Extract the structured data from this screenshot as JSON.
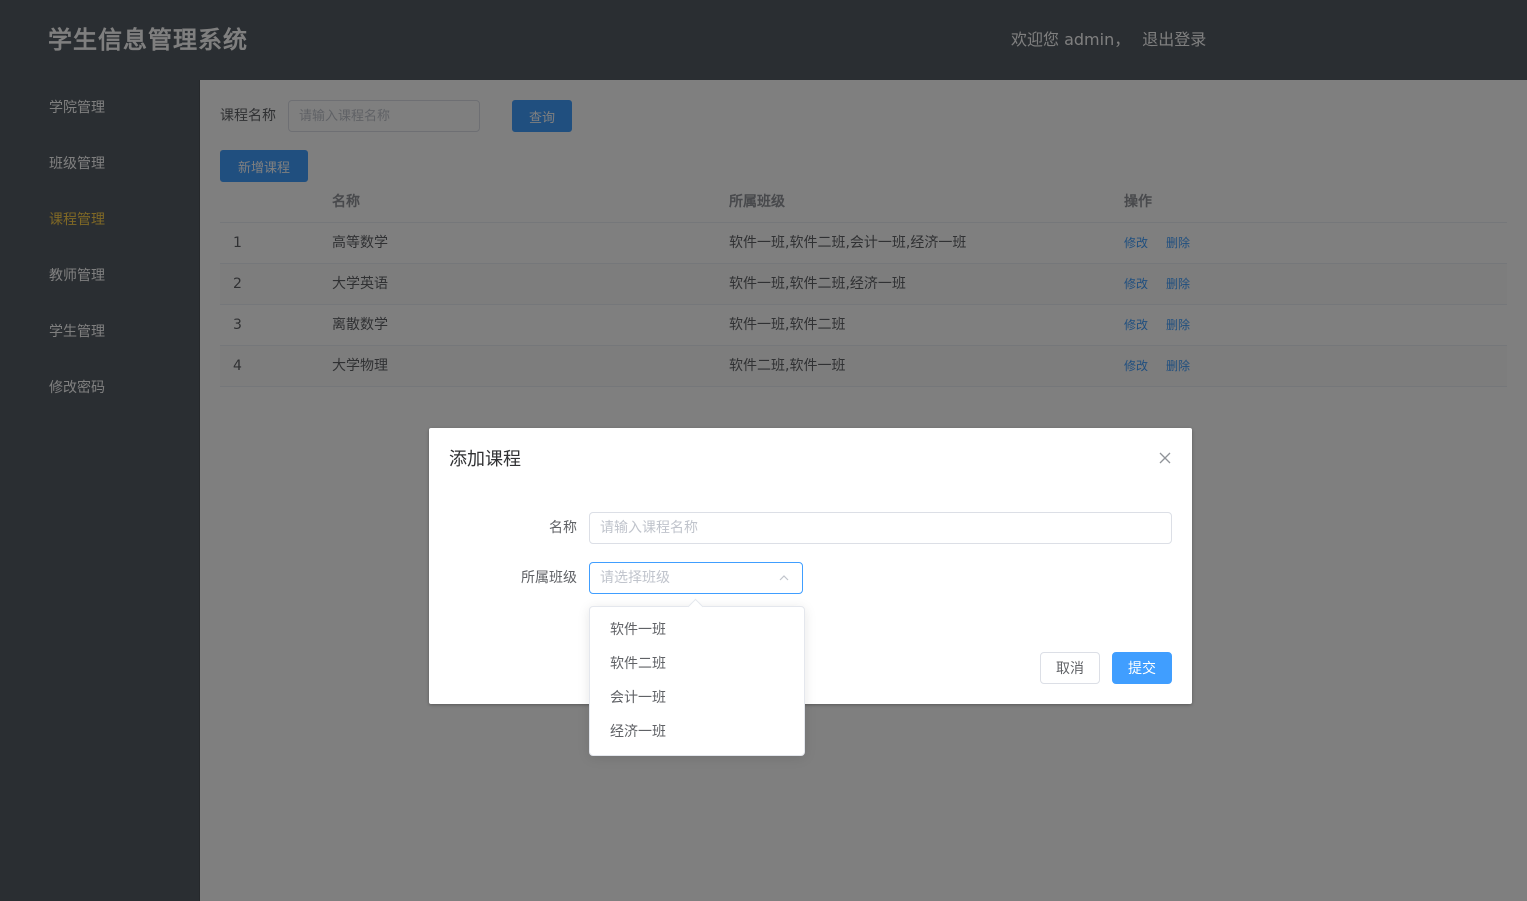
{
  "header": {
    "title": "学生信息管理系统",
    "welcome": "欢迎您 admin，",
    "logout": "退出登录"
  },
  "sidebar": {
    "items": [
      {
        "label": "学院管理",
        "active": false
      },
      {
        "label": "班级管理",
        "active": false
      },
      {
        "label": "课程管理",
        "active": true
      },
      {
        "label": "教师管理",
        "active": false
      },
      {
        "label": "学生管理",
        "active": false
      },
      {
        "label": "修改密码",
        "active": false
      }
    ]
  },
  "search": {
    "label": "课程名称",
    "placeholder": "请输入课程名称",
    "query_button": "查询"
  },
  "toolbar": {
    "add_button": "新增课程"
  },
  "table": {
    "columns": [
      "",
      "名称",
      "所属班级",
      "操作"
    ],
    "rows": [
      {
        "index": "1",
        "name": "高等数学",
        "classes": "软件一班,软件二班,会计一班,经济一班"
      },
      {
        "index": "2",
        "name": "大学英语",
        "classes": "软件一班,软件二班,经济一班"
      },
      {
        "index": "3",
        "name": "离散数学",
        "classes": "软件一班,软件二班"
      },
      {
        "index": "4",
        "name": "大学物理",
        "classes": "软件二班,软件一班"
      }
    ],
    "edit_label": "修改",
    "delete_label": "删除"
  },
  "dialog": {
    "title": "添加课程",
    "name_label": "名称",
    "name_placeholder": "请输入课程名称",
    "class_label": "所属班级",
    "class_placeholder": "请选择班级",
    "class_options": [
      "软件一班",
      "软件二班",
      "会计一班",
      "经济一班"
    ],
    "cancel_button": "取消",
    "submit_button": "提交"
  },
  "colors": {
    "header_bg": "#545c64",
    "active_menu": "#ffd04b",
    "primary": "#409eff"
  }
}
